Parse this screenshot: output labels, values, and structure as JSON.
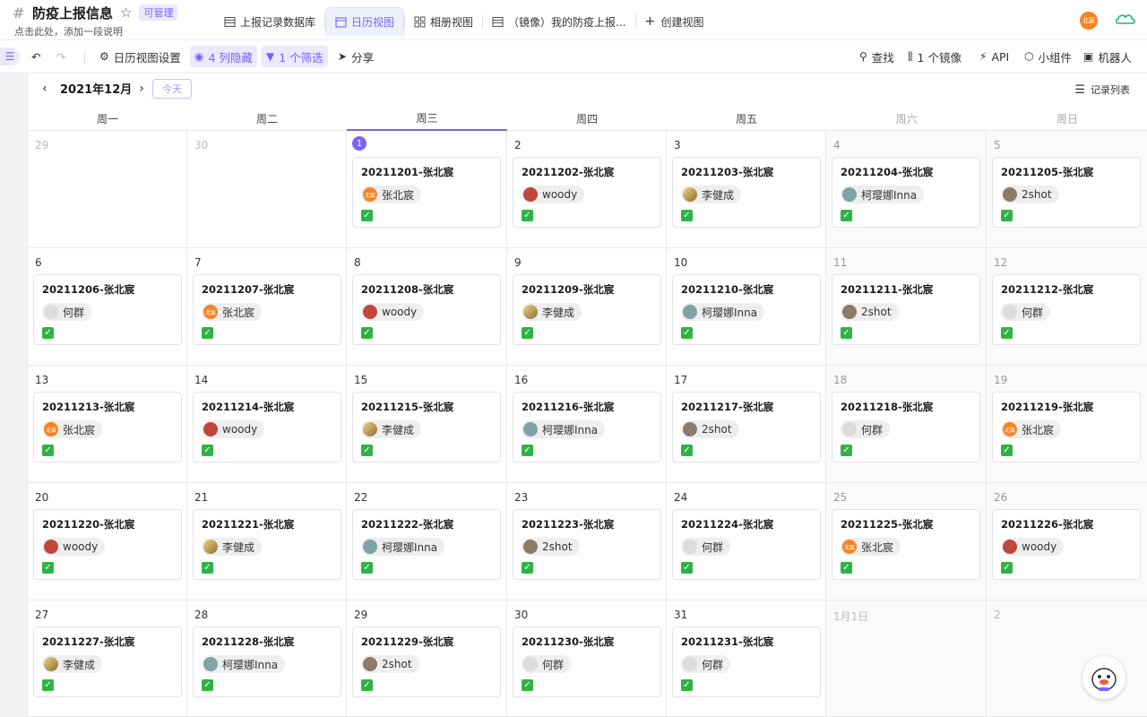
{
  "header": {
    "title": "防疫上报信息",
    "permission": "可管理",
    "description": "点击此处，添加一段说明",
    "user_avatar_text": "北宸"
  },
  "tabs": [
    {
      "label": "上报记录数据库",
      "icon": "table-icon",
      "active": false
    },
    {
      "label": "日历视图",
      "icon": "calendar-icon",
      "active": true
    },
    {
      "label": "相册视图",
      "icon": "gallery-icon",
      "active": false
    },
    {
      "label": "（镜像）我的防疫上报...",
      "icon": "table-icon",
      "active": false
    },
    {
      "label": "创建视图",
      "icon": "plus-icon",
      "active": false
    }
  ],
  "toolbar": {
    "settings": "日历视图设置",
    "hidden": "4 列隐藏",
    "filter": "1 个筛选",
    "share": "分享",
    "find": "查找",
    "mirror": "1 个镜像",
    "api": "API",
    "widget": "小组件",
    "robot": "机器人"
  },
  "calendar": {
    "month": "2021年12月",
    "today_btn": "今天",
    "record_list": "记录列表",
    "weekdays": [
      "周一",
      "周二",
      "周三",
      "周四",
      "周五",
      "周六",
      "周日"
    ],
    "days": [
      {
        "d": "29"
      },
      {
        "d": "30"
      },
      {
        "d": "1",
        "title": "20211201-张北宸",
        "person": "张北宸"
      },
      {
        "d": "2",
        "title": "20211202-张北宸",
        "person": "woody"
      },
      {
        "d": "3",
        "title": "20211203-张北宸",
        "person": "李健成"
      },
      {
        "d": "4",
        "title": "20211204-张北宸",
        "person": "柯璎娜Inna"
      },
      {
        "d": "5",
        "title": "20211205-张北宸",
        "person": "2shot"
      },
      {
        "d": "6",
        "title": "20211206-张北宸",
        "person": "何群"
      },
      {
        "d": "7",
        "title": "20211207-张北宸",
        "person": "张北宸"
      },
      {
        "d": "8",
        "title": "20211208-张北宸",
        "person": "woody"
      },
      {
        "d": "9",
        "title": "20211209-张北宸",
        "person": "李健成"
      },
      {
        "d": "10",
        "title": "20211210-张北宸",
        "person": "柯璎娜Inna"
      },
      {
        "d": "11",
        "title": "20211211-张北宸",
        "person": "2shot"
      },
      {
        "d": "12",
        "title": "20211212-张北宸",
        "person": "何群"
      },
      {
        "d": "13",
        "title": "20211213-张北宸",
        "person": "张北宸"
      },
      {
        "d": "14",
        "title": "20211214-张北宸",
        "person": "woody"
      },
      {
        "d": "15",
        "title": "20211215-张北宸",
        "person": "李健成"
      },
      {
        "d": "16",
        "title": "20211216-张北宸",
        "person": "柯璎娜Inna"
      },
      {
        "d": "17",
        "title": "20211217-张北宸",
        "person": "2shot"
      },
      {
        "d": "18",
        "title": "20211218-张北宸",
        "person": "何群"
      },
      {
        "d": "19",
        "title": "20211219-张北宸",
        "person": "张北宸"
      },
      {
        "d": "20",
        "title": "20211220-张北宸",
        "person": "woody"
      },
      {
        "d": "21",
        "title": "20211221-张北宸",
        "person": "李健成"
      },
      {
        "d": "22",
        "title": "20211222-张北宸",
        "person": "柯璎娜Inna"
      },
      {
        "d": "23",
        "title": "20211223-张北宸",
        "person": "2shot"
      },
      {
        "d": "24",
        "title": "20211224-张北宸",
        "person": "何群"
      },
      {
        "d": "25",
        "title": "20211225-张北宸",
        "person": "张北宸"
      },
      {
        "d": "26",
        "title": "20211226-张北宸",
        "person": "woody"
      },
      {
        "d": "27",
        "title": "20211227-张北宸",
        "person": "李健成"
      },
      {
        "d": "28",
        "title": "20211228-张北宸",
        "person": "柯璎娜Inna"
      },
      {
        "d": "29",
        "title": "20211229-张北宸",
        "person": "2shot"
      },
      {
        "d": "30",
        "title": "20211230-张北宸",
        "person": "何群"
      },
      {
        "d": "31",
        "title": "20211231-张北宸",
        "person": "何群"
      },
      {
        "d": "1月1日"
      },
      {
        "d": "2"
      }
    ]
  },
  "colors": {
    "accent": "#7b61ff",
    "check": "#2fb344"
  }
}
